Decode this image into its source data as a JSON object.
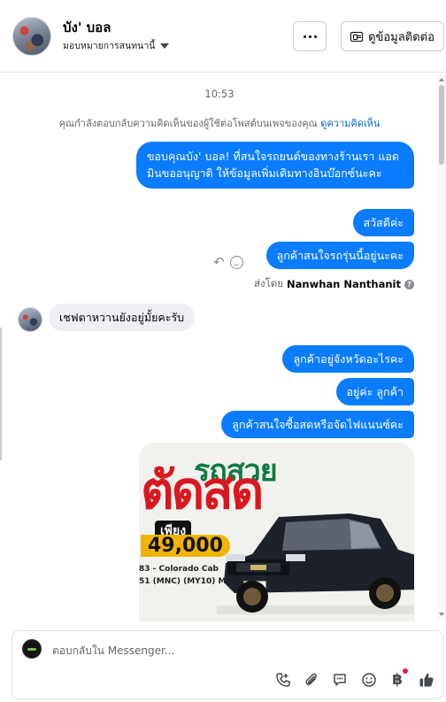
{
  "header": {
    "contact_name": "บัง' บอล",
    "assign_label": "มอบหมายการสนทนานี้",
    "more_button": "...",
    "contact_info_button": "ดูข้อมูลติดต่อ"
  },
  "thread": {
    "timestamp": "10:53",
    "notice_text": "คุณกำลังตอบกลับความคิดเห็นของผู้ใช้ต่อโพสต์บนเพจของคุณ",
    "notice_link": "ดูความคิดเห็น",
    "messages": [
      {
        "from": "page",
        "text": "ขอบคุณบัง' บอล! ที่สนใจรถยนต์ของทางร้านเรา แอดมินขออนุญาติ ให้ข้อมูลเพิ่มเติมทางอินบ๊อกซ์นะคะ"
      },
      {
        "from": "page",
        "text": "สวัสดีค่ะ"
      },
      {
        "from": "page",
        "text": "ลูกค้าสนใจรถรุ่นนี้อยู่นะคะ"
      },
      {
        "from": "user",
        "text": "เชฟตาหวานยังอยู่มั้ยคะรับ"
      },
      {
        "from": "page",
        "text": "ลูกค้าอยู่จังหวัดอะไรคะ"
      },
      {
        "from": "page",
        "text": "อยู่ค่ะ ลูกค้า"
      },
      {
        "from": "page",
        "text": "ลูกค้าสนใจซื้อสดหรือจัดไฟแนนซ์คะ"
      }
    ],
    "sent_by_label": "ส่งโดย",
    "sent_by_name": "Nanwhan Nanthanit",
    "help_icon": "?",
    "promo_image": {
      "line1": "รถสวย",
      "line2": "ตัดสด",
      "price_lead": "เพียง",
      "price": "49,000",
      "model_line1": "83 - Colorado Cab",
      "model_line2": "51 (MNC) (MY10) M"
    }
  },
  "composer": {
    "placeholder": "ตอบกลับใน Messenger..."
  },
  "colors": {
    "outgoing_bubble": "#0a7cff",
    "incoming_bubble": "#eeeff2",
    "link": "#0a66c2"
  }
}
